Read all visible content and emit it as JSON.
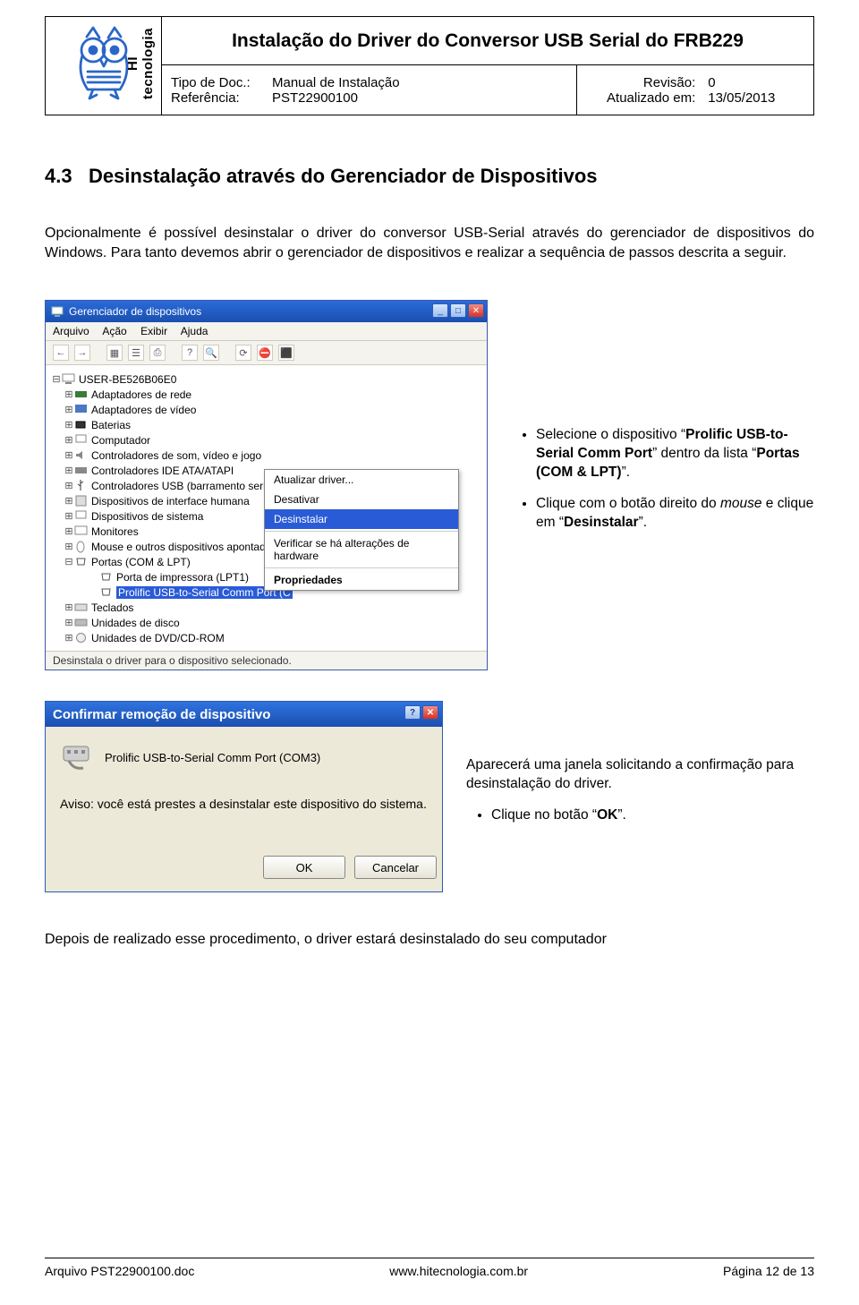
{
  "header": {
    "brand_label": "HI tecnologia",
    "title": "Instalação do Driver do Conversor USB Serial do FRB229",
    "meta_left": {
      "row1": {
        "k": "Tipo de Doc.:",
        "v": "Manual de Instalação"
      },
      "row2": {
        "k": "Referência:",
        "v": "PST22900100"
      }
    },
    "meta_right": {
      "row1": {
        "k": "Revisão:",
        "v": "0"
      },
      "row2": {
        "k": "Atualizado em:",
        "v": "13/05/2013"
      }
    }
  },
  "section": {
    "number": "4.3",
    "title": "Desinstalação através do Gerenciador de Dispositivos",
    "paragraph": "Opcionalmente é possível desinstalar o driver do conversor USB-Serial através do gerenciador de dispositivos do Windows. Para tanto devemos abrir o gerenciador de dispositivos e realizar a sequência de passos descrita a seguir."
  },
  "fig1": {
    "bullets": [
      {
        "pre": "Selecione o dispositivo “",
        "bold": "Prolific USB-to-Serial Comm Port",
        "post": "” dentro da lista “",
        "bold2": "Portas (COM & LPT)",
        "tail": "”."
      },
      {
        "pre": "Clique com o botão direito do ",
        "ital": "mouse",
        "post": " e clique em “",
        "bold": "Desinstalar",
        "tail": "”."
      }
    ]
  },
  "dm": {
    "title": "Gerenciador de dispositivos",
    "menu": [
      "Arquivo",
      "Ação",
      "Exibir",
      "Ajuda"
    ],
    "root": "USER-BE526B06E0",
    "nodes": [
      "Adaptadores de rede",
      "Adaptadores de vídeo",
      "Baterias",
      "Computador",
      "Controladores de som, vídeo e jogo",
      "Controladores IDE ATA/ATAPI",
      "Controladores USB (barramento serial universal)",
      "Dispositivos de interface humana",
      "Dispositivos de sistema",
      "Monitores",
      "Mouse e outros dispositivos apontadores",
      "Portas (COM & LPT)"
    ],
    "ports_children": [
      "Porta de impressora (LPT1)",
      "Prolific USB-to-Serial Comm Port (C"
    ],
    "nodes_after": [
      "Teclados",
      "Unidades de disco",
      "Unidades de DVD/CD-ROM"
    ],
    "context": [
      "Atualizar driver...",
      "Desativar",
      "Desinstalar",
      "Verificar se há alterações de hardware",
      "Propriedades"
    ],
    "status": "Desinstala o driver para o dispositivo selecionado."
  },
  "fig2": {
    "lead": "Aparecerá uma janela solicitando a confirmação para desinstalação do driver.",
    "bullet_pre": "Clique no botão “",
    "bullet_bold": "OK",
    "bullet_tail": "”."
  },
  "cd": {
    "title": "Confirmar remoção de dispositivo",
    "device": "Prolific USB-to-Serial Comm Port (COM3)",
    "warn": "Aviso: você está prestes a desinstalar este dispositivo do sistema.",
    "ok": "OK",
    "cancel": "Cancelar"
  },
  "closing": "Depois de realizado esse procedimento, o driver estará desinstalado do seu computador",
  "footer": {
    "left": "Arquivo PST22900100.doc",
    "center": "www.hitecnologia.com.br",
    "right": "Página 12 de 13"
  }
}
